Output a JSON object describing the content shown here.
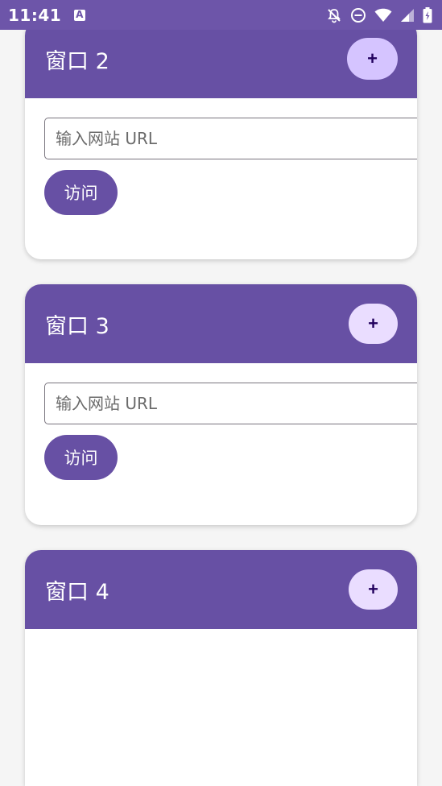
{
  "status_bar": {
    "time": "11:41",
    "icons": [
      "keyboard-a-icon",
      "bell-off-icon",
      "do-not-disturb-icon",
      "wifi-icon",
      "cell-signal-icon",
      "battery-charging-icon"
    ]
  },
  "colors": {
    "status_bar": "#6d55a9",
    "header": "#6750a4",
    "add_button": "#eaddff",
    "add_button_pressed": "#d5c4ff",
    "background": "#f5f5f5"
  },
  "windows": [
    {
      "title": "窗口 2",
      "add_label": "+",
      "url_placeholder": "输入网站 URL",
      "url_value": "",
      "visit_label": "访问"
    },
    {
      "title": "窗口 3",
      "add_label": "+",
      "url_placeholder": "输入网站 URL",
      "url_value": "",
      "visit_label": "访问"
    },
    {
      "title": "窗口 4",
      "add_label": "+"
    }
  ]
}
